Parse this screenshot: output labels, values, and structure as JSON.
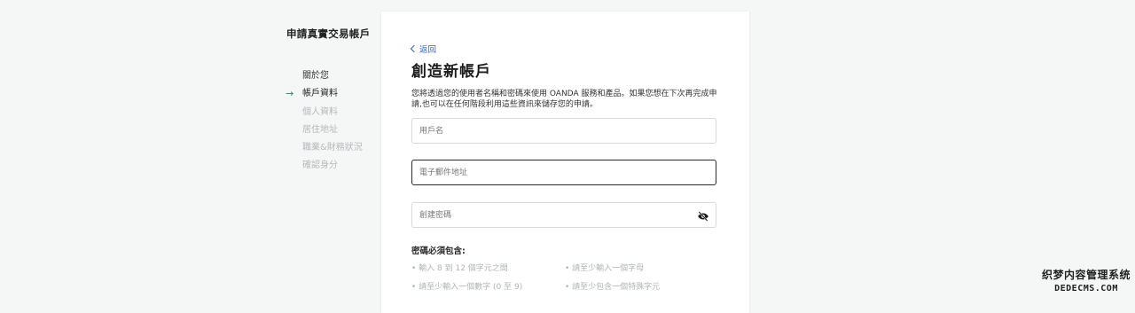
{
  "sidebar": {
    "title": "申請真實交易帳戶",
    "steps": [
      {
        "label": "關於您",
        "state": "done",
        "marker": ""
      },
      {
        "label": "帳戶資料",
        "state": "current",
        "marker": "→"
      },
      {
        "label": "個人資料",
        "state": "pending",
        "marker": ""
      },
      {
        "label": "居住地址",
        "state": "pending",
        "marker": ""
      },
      {
        "label": "職業&財務狀況",
        "state": "pending",
        "marker": ""
      },
      {
        "label": "確認身分",
        "state": "pending",
        "marker": ""
      }
    ],
    "current_arrow_color": "#2d8a4a"
  },
  "form": {
    "back_label": "返回",
    "title": "創造新帳戶",
    "intro": "您將透過您的使用者名稱和密碼來使用 OANDA 服務和產品。如果您想在下次再完成申請,也可以在任何階段利用這些資訊來儲存您的申請。",
    "username": {
      "placeholder": "用戶名",
      "value": ""
    },
    "email": {
      "placeholder": "電子郵件地址",
      "value": ""
    },
    "password": {
      "placeholder": "創建密碼",
      "value": "",
      "toggle_icon": "eye-slash-icon"
    },
    "requirements_title": "密碼必須包含:",
    "requirements": [
      "• 輸入 8 到 12 個字元之間",
      "• 請至少輸入一個字母",
      "• 請至少輸入一個數字 (0 至 9)",
      "• 請至少包含一個特殊字元"
    ]
  },
  "watermark": {
    "line1": "织梦内容管理系统",
    "line2": "DEDECMS.COM"
  },
  "colors": {
    "link": "#2d67c5",
    "page_bg": "#f5f6f6",
    "card_bg": "#ffffff",
    "pending_text": "#b5b9bc"
  }
}
